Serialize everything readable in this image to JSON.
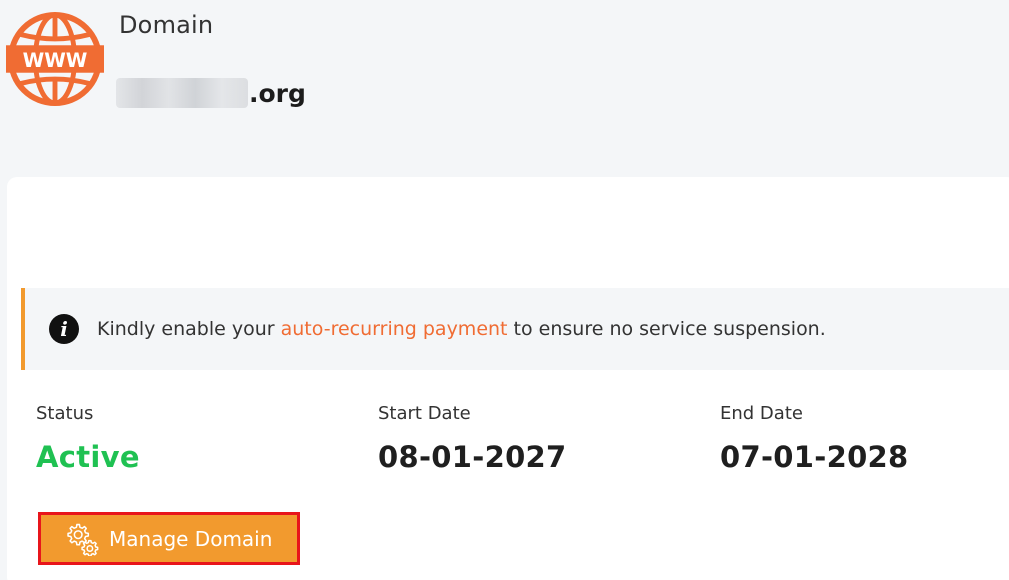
{
  "header": {
    "icon": "globe-www-icon",
    "icon_text": "WWW",
    "label": "Domain",
    "domain_tld": ".org"
  },
  "notice": {
    "icon": "info-icon",
    "icon_glyph": "i",
    "text_before": "Kindly enable your ",
    "link_text": "auto-recurring payment",
    "text_after": " to ensure no service suspension."
  },
  "details": {
    "status_label": "Status",
    "status_value": "Active",
    "start_label": "Start Date",
    "start_value": "08-01-2027",
    "end_label": "End Date",
    "end_value": "07-01-2028"
  },
  "actions": {
    "manage_label": "Manage Domain",
    "manage_icon": "gears-icon"
  },
  "colors": {
    "accent_orange": "#f29a2e",
    "link_orange": "#f06c33",
    "status_green": "#1fc152",
    "highlight_red": "#e8151b",
    "page_background": "#f4f6f8"
  }
}
